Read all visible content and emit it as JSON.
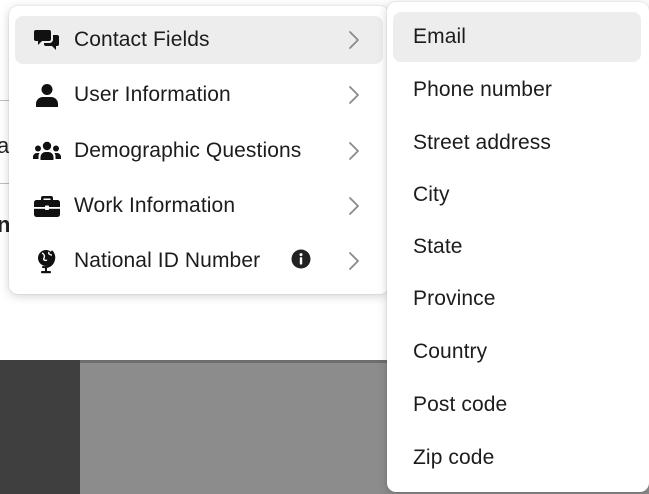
{
  "background": {
    "fragment_a": "a",
    "fragment_n": "n"
  },
  "primary_menu": {
    "items": [
      {
        "label": "Contact Fields",
        "icon": "chat-bubbles-icon"
      },
      {
        "label": "User Information",
        "icon": "user-icon"
      },
      {
        "label": "Demographic Questions",
        "icon": "users-group-icon"
      },
      {
        "label": "Work Information",
        "icon": "briefcase-icon"
      },
      {
        "label": "National ID Number",
        "icon": "globe-icon",
        "info_icon": "info-icon"
      }
    ],
    "active_item": "Contact Fields"
  },
  "submenu": {
    "items": [
      "Email",
      "Phone number",
      "Street address",
      "City",
      "State",
      "Province",
      "Country",
      "Post code",
      "Zip code"
    ],
    "active_item": "Email"
  },
  "colors": {
    "menu_bg": "#ffffff",
    "hover_bg": "#ededed",
    "text": "#1c1c1c",
    "chevron": "#8a8a8a",
    "backdrop_gray": "#8c8c8c",
    "backdrop_dark": "#3f3f3f"
  }
}
